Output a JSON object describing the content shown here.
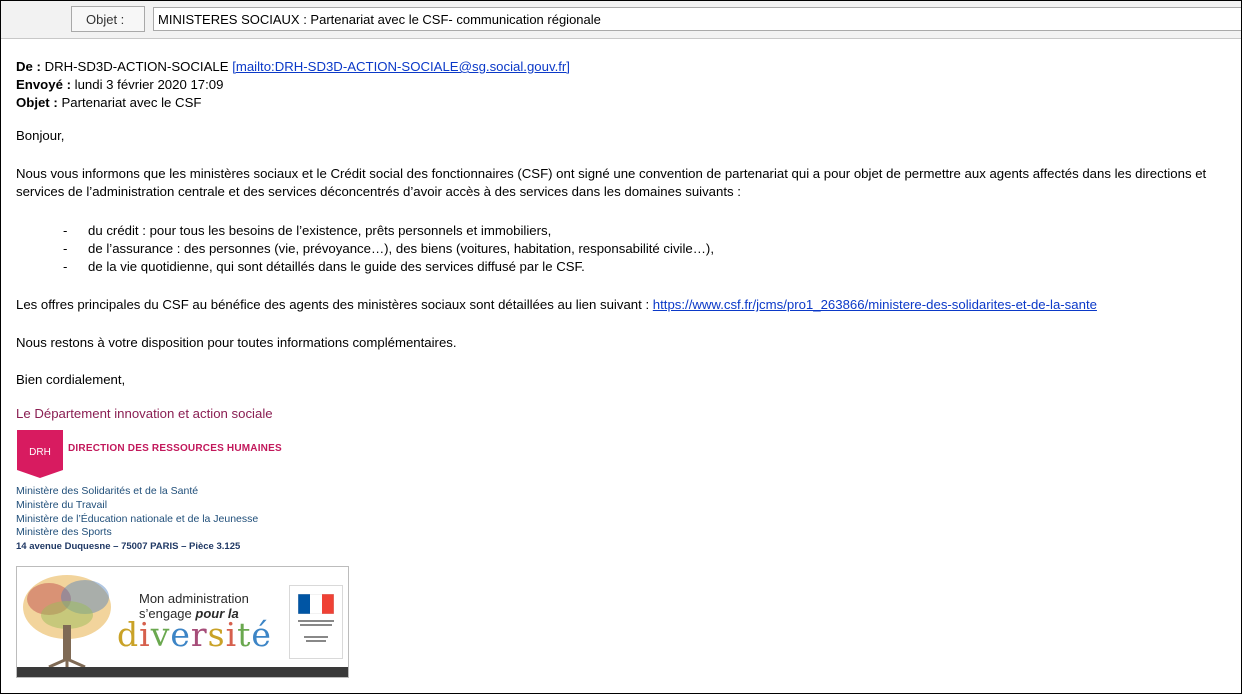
{
  "header": {
    "objet_label": "Objet :",
    "objet_value": "MINISTERES SOCIAUX : Partenariat avec le CSF- communication régionale"
  },
  "meta": {
    "de_label": "De :",
    "de_value": "DRH-SD3D-ACTION-SOCIALE",
    "de_link": "[mailto:DRH-SD3D-ACTION-SOCIALE@sg.social.gouv.fr]",
    "envoye_label": "Envoyé :",
    "envoye_value": "lundi 3 février 2020 17:09",
    "objet_label": "Objet :",
    "objet_value": "Partenariat avec le CSF"
  },
  "body": {
    "greeting": "Bonjour,",
    "intro": "Nous vous informons que les ministères sociaux et le Crédit social des fonctionnaires (CSF) ont signé une convention de partenariat qui a pour objet de permettre aux agents affectés dans les directions et services de l’administration centrale et des services déconcentrés d’avoir accès à des services dans les domaines suivants :",
    "list_dash": "-",
    "list": [
      "du crédit : pour tous les besoins de l’existence, prêts personnels et immobiliers,",
      "de l’assurance : des personnes (vie, prévoyance…), des biens (voitures, habitation, responsabilité civile…),",
      "de la vie quotidienne, qui sont détaillés dans le guide des services diffusé par le CSF."
    ],
    "offers_text": "Les offres principales du CSF au bénéfice des agents des ministères sociaux sont détaillées au lien suivant : ",
    "offers_link": "https://www.csf.fr/jcms/pro1_263866/ministere-des-solidarites-et-de-la-sante",
    "disposition": "Nous restons à votre disposition pour toutes informations complémentaires.",
    "closing": "Bien cordialement,"
  },
  "signature": {
    "department": "Le Département innovation et action sociale",
    "drh_badge": "DRH",
    "drh_title": "DIRECTION DES RESSOURCES HUMAINES",
    "ministries": [
      "Ministère des Solidarités et de la Santé",
      "Ministère du Travail",
      "Ministère de l’Éducation nationale et de la Jeunesse",
      "Ministère des Sports"
    ],
    "address": "14 avenue Duquesne – 75007 PARIS – Pièce 3.125"
  },
  "banner": {
    "line1": "Mon administration",
    "line2_prefix": "s’engage ",
    "line2_emphasis": "pour la",
    "diversity_letters": [
      "d",
      "i",
      "v",
      "e",
      "r",
      "s",
      "i",
      "t",
      "é"
    ],
    "colors": {
      "pink": "#c2185b",
      "link": "#0b39c8",
      "dept": "#8a1e52"
    }
  }
}
